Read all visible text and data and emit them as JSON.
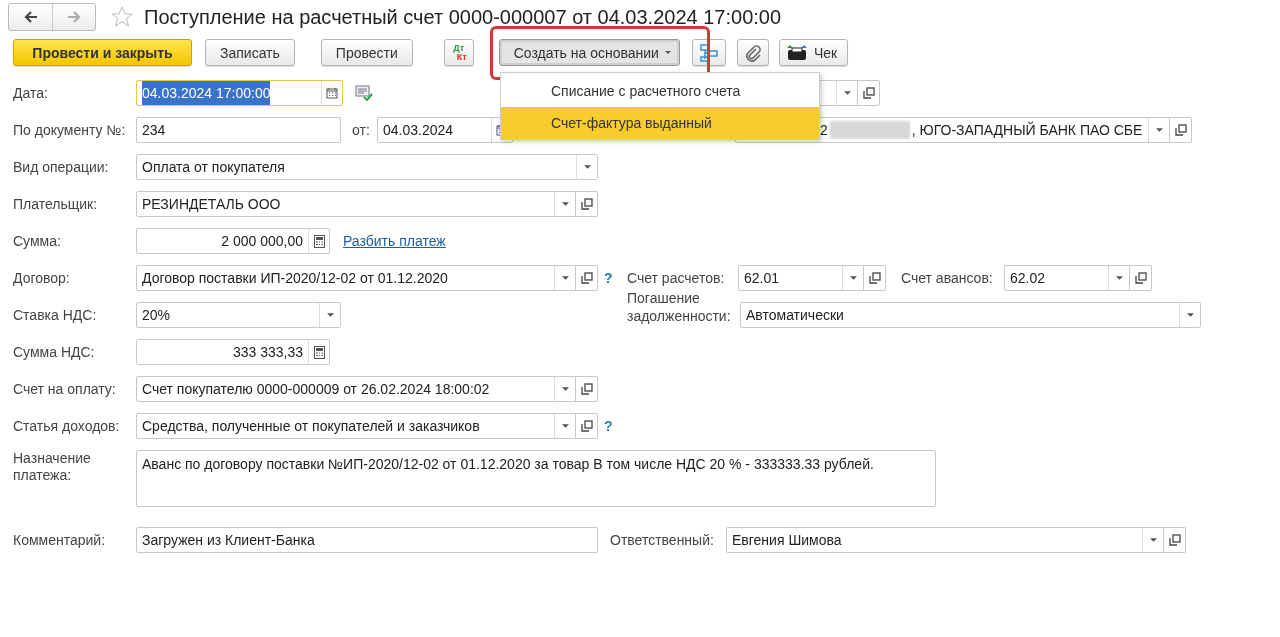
{
  "window": {
    "title": "Поступление на расчетный счет 0000-000007 от 04.03.2024 17:00:00",
    "favorite": false
  },
  "toolbar": [
    {
      "kind": "default",
      "label": "Провести и закрыть"
    },
    {
      "kind": "plain",
      "label": "Записать"
    },
    {
      "kind": "plain",
      "label": "Провести"
    },
    {
      "kind": "dtkt",
      "lines": [
        "Дт",
        "Кт"
      ]
    },
    {
      "kind": "menu",
      "label": "Создать на основании",
      "pressed": true
    },
    {
      "kind": "structure"
    },
    {
      "kind": "clip"
    },
    {
      "kind": "receipt",
      "label": "Чек"
    }
  ],
  "menu": {
    "items": [
      {
        "label": "Списание с расчетного счета",
        "selected": false
      },
      {
        "label": "Счет-фактура выданный",
        "selected": true
      }
    ]
  },
  "rows": [
    {
      "items": [
        {
          "kind": "label",
          "text": "Дата:"
        },
        {
          "kind": "date",
          "value": "04.03.2024 17:00:00",
          "focused": true
        },
        {
          "kind": "posted_icon"
        },
        {
          "kind": "select",
          "open": true
        }
      ]
    },
    {
      "items": [
        {
          "kind": "label",
          "text": "По документу №:"
        },
        {
          "kind": "text",
          "value": "234"
        },
        {
          "kind": "label",
          "text": "от:"
        },
        {
          "kind": "date",
          "value": "04.03.2024"
        },
        {
          "kind": "select",
          "open": true,
          "value_parts": [
            "2",
            ", ЮГО-ЗАПАДНЫЙ БАНК ПАО СБЕ"
          ]
        }
      ]
    },
    {
      "items": [
        {
          "kind": "label",
          "text": "Вид операции:"
        },
        {
          "kind": "select",
          "value": "Оплата от покупателя",
          "open": false
        }
      ]
    },
    {
      "items": [
        {
          "kind": "label",
          "text": "Плательщик:"
        },
        {
          "kind": "select",
          "value": "РЕЗИНДЕТАЛЬ ООО",
          "open": true
        }
      ]
    },
    {
      "items": [
        {
          "kind": "label",
          "text": "Сумма:"
        },
        {
          "kind": "number",
          "value": "2 000 000,00"
        },
        {
          "kind": "link",
          "text": "Разбить платеж"
        }
      ]
    },
    {
      "items": [
        {
          "kind": "label",
          "text": "Договор:"
        },
        {
          "kind": "select",
          "value": "Договор поставки ИП-2020/12-02 от 01.12.2020",
          "open": true
        },
        {
          "kind": "help",
          "text": "?"
        },
        {
          "kind": "label",
          "text": "Счет расчетов:"
        },
        {
          "kind": "select",
          "value": "62.01",
          "open": true
        },
        {
          "kind": "label",
          "text": "Счет авансов:"
        },
        {
          "kind": "select",
          "value": "62.02",
          "open": true
        }
      ]
    },
    {
      "items": [
        {
          "kind": "label",
          "text": "Ставка НДС:"
        },
        {
          "kind": "select",
          "value": "20%",
          "open": false
        },
        {
          "kind": "label",
          "text": "Погашение задолженности:"
        },
        {
          "kind": "select",
          "value": "Автоматически",
          "open": false
        }
      ]
    },
    {
      "items": [
        {
          "kind": "label",
          "text": "Сумма НДС:"
        },
        {
          "kind": "number",
          "value": "333 333,33"
        }
      ]
    },
    {
      "items": [
        {
          "kind": "label",
          "text": "Счет на оплату:"
        },
        {
          "kind": "select",
          "value": "Счет покупателю 0000-000009 от 26.02.2024 18:00:02",
          "open": true
        }
      ]
    },
    {
      "items": [
        {
          "kind": "label",
          "text": "Статья доходов:"
        },
        {
          "kind": "select",
          "value": "Средства, полученные от покупателей и заказчиков",
          "open": true
        },
        {
          "kind": "help",
          "text": "?"
        }
      ]
    },
    {
      "items": [
        {
          "kind": "label",
          "text": "Назначение платежа:"
        },
        {
          "kind": "textarea",
          "value": "Аванс по договору поставки №ИП-2020/12-02 от 01.12.2020 за товар В том числе НДС 20 % - 333333.33 рублей."
        }
      ]
    },
    {
      "items": [
        {
          "kind": "label",
          "text": "Комментарий:"
        },
        {
          "kind": "text",
          "value": "Загружен из Клиент-Банка"
        },
        {
          "kind": "label",
          "text": "Ответственный:"
        },
        {
          "kind": "select",
          "value": "Евгения Шимова",
          "open": true
        }
      ]
    }
  ]
}
